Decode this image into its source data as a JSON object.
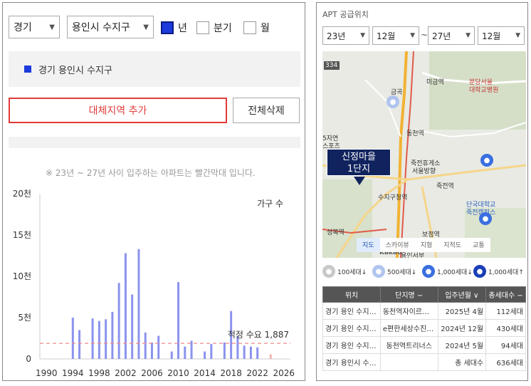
{
  "controls": {
    "region": "경기",
    "district": "용인시 수지구",
    "period_options": [
      {
        "label": "년",
        "checked": true
      },
      {
        "label": "분기",
        "checked": false
      },
      {
        "label": "월",
        "checked": false
      }
    ]
  },
  "legend": {
    "label": "경기 용인시 수지구",
    "color": "#1c3bdc"
  },
  "buttons": {
    "add_region": "대체지역 추가",
    "delete_all": "전체삭제"
  },
  "note": "※ 23년 ~ 27년 사이 입주하는 아파트는 빨간막대 입니다.",
  "chart_data": {
    "type": "bar",
    "legend": "가구 수",
    "y_ticks": [
      "0",
      "5천",
      "10천",
      "15천",
      "20천"
    ],
    "x_ticks": [
      "1990",
      "1994",
      "1998",
      "2002",
      "2006",
      "2010",
      "2014",
      "2018",
      "2022",
      "2026"
    ],
    "ylim": [
      0,
      20000
    ],
    "xlim": [
      1989,
      2027
    ],
    "reference_line": {
      "label": "적정 수요 1,887",
      "value": 1887,
      "color": "#f08a8a"
    },
    "bar_color": "#8b93ee",
    "highlight_color": "#f6b3b3",
    "series": [
      {
        "years": [
          1994,
          1995,
          1997,
          1998,
          1999,
          2000,
          2001,
          2002,
          2003,
          2004,
          2005,
          2006,
          2007,
          2009,
          2010,
          2011,
          2012,
          2014,
          2015,
          2017,
          2018,
          2019,
          2020,
          2021,
          2022,
          2024
        ],
        "values": [
          5000,
          3500,
          4900,
          4600,
          4800,
          5700,
          9200,
          12800,
          7800,
          13300,
          3200,
          2000,
          2800,
          900,
          9300,
          1500,
          2200,
          900,
          1800,
          2000,
          5800,
          2800,
          1600,
          1500,
          1400,
          560
        ]
      }
    ]
  },
  "map_panel": {
    "title": "APT 공급위치",
    "from_year": "23년",
    "from_month": "12월",
    "tilde": "~",
    "to_year": "27년",
    "to_month": "12월",
    "callout_line1": "신정마을",
    "callout_line2": "1단지",
    "labels": [
      "334",
      "미금역",
      "분당서울",
      "대학교병원",
      "금곡",
      "동천역",
      "죽전휴게소",
      "서울방향",
      "수지구청역",
      "죽전역",
      "단국대학교",
      "죽전캠퍼스",
      "성복역",
      "보정역",
      "용인서부",
      "5자연",
      "스포츠",
      "Kakao"
    ],
    "tabs": [
      "지도",
      "스카이뷰",
      "지형",
      "지적도",
      "교통"
    ],
    "active_tab": "지도",
    "pin_legend": [
      {
        "label": "100세대↓",
        "color": "#c8c8c8"
      },
      {
        "label": "500세대↓",
        "color": "#b0c4ef"
      },
      {
        "label": "1,000세대↓",
        "color": "#3a6fe0"
      },
      {
        "label": "1,000세대↑",
        "color": "#1a3fb8"
      }
    ]
  },
  "table": {
    "headers": [
      "위치",
      "단지명 −",
      "입주년월 ∨",
      "총세대수 −"
    ],
    "rows": [
      [
        "경기 용인 수지구…",
        "동천역자이르네(도…",
        "2025년 4월",
        "112세대"
      ],
      [
        "경기 용인 수지구…",
        "e편한세상수진프리…",
        "2024년 12월",
        "430세대"
      ],
      [
        "경기 용인 수지구…",
        "동천역트리너스",
        "2024년 5월",
        "94세대"
      ]
    ],
    "total": {
      "location": "경기 용인시 수지구",
      "label": "총 세대수",
      "value": "636세대"
    }
  }
}
